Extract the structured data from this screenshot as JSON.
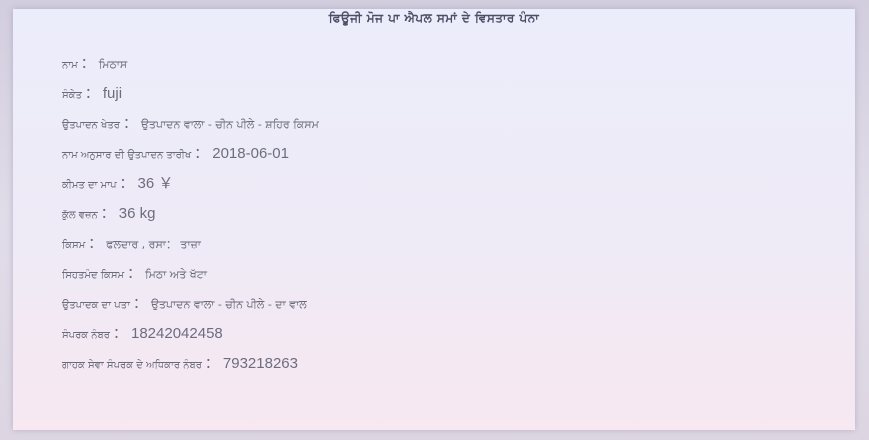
{
  "title": "ਫਿਊਜੀ ਮੋਜ ਪਾ ਐਪਲ ਸਮਾਂ ਦੇ ਵਿਸਤਾਰ ਪੰਨਾ",
  "fields": [
    {
      "label": "ਨਾਮ",
      "sep": "：",
      "value": "ਮਿਠਾਸ",
      "value_big": false
    },
    {
      "label": "ਸੰਕੇਤ",
      "sep": "：",
      "value": "fuji",
      "value_big": true
    },
    {
      "label": "ਉਤਪਾਦਨ ਖੇਤਰ",
      "sep": "：",
      "value": "ਉਤਪਾਦਨ ਵਾਲਾ - ਚੀਨ ਪੀਲੇ - ਸ਼ਹਿਰ ਕਿਸਮ",
      "value_big": false
    },
    {
      "label": "ਨਾਮ ਅਨੁਸਾਰ ਦੀ ਉਤਪਾਦਨ ਤਾਰੀਖ",
      "sep": "：",
      "value": "2018-06-01",
      "value_big": true
    },
    {
      "label": "ਕੀਮਤ ਦਾ ਮਾਪ",
      "sep": "：",
      "value": "36 ￥",
      "value_big": true
    },
    {
      "label": "ਕੁੱਲ ਵਜ਼ਨ",
      "sep": "：",
      "value": "36 kg",
      "value_big": true
    },
    {
      "label": "ਕਿਸਮ",
      "sep": "：",
      "value": "ਫਲਦਾਰ ,  ਰਸਾ：  ਤਾਜ਼ਾ",
      "value_big": false
    },
    {
      "label": "ਸਿਹਤਮੰਦ ਕਿਸਮ",
      "sep": "：",
      "value": "ਮਿਠਾ ਅਤੇ ਖੱਟਾ",
      "value_big": false
    },
    {
      "label": "ਉਤਪਾਦਕ ਦਾ ਪਤਾ",
      "sep": "：",
      "value": "ਉਤਪਾਦਨ ਵਾਲਾ - ਚੀਨ ਪੀਲੇ - ਦਾ ਵਾਲ",
      "value_big": false
    },
    {
      "label": "ਸੰਪਰਕ ਨੰਬਰ",
      "sep": "：",
      "value": "18242042458",
      "value_big": true
    },
    {
      "label": "ਗਾਹਕ ਸੇਵਾ ਸੰਪਰਕ ਦੇ ਅਧਿਕਾਰ ਨੰਬਰ",
      "sep": "：",
      "value": "793218263",
      "value_big": true
    }
  ]
}
